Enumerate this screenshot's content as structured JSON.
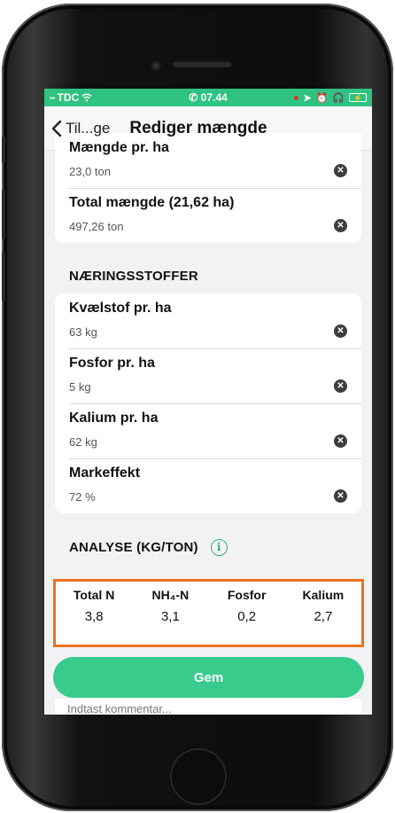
{
  "status_bar": {
    "carrier": "TDC",
    "time": "07.44"
  },
  "nav": {
    "back_label": "Til...ge",
    "title": "Rediger mængde"
  },
  "quantity_fields": [
    {
      "label": "Mængde pr. ha",
      "value": "23,0 ton"
    },
    {
      "label": "Total mængde (21,62 ha)",
      "value": "497,26 ton"
    }
  ],
  "nutrients": {
    "title": "NÆRINGSSTOFFER",
    "fields": [
      {
        "label": "Kvælstof pr. ha",
        "value": "63 kg"
      },
      {
        "label": "Fosfor pr. ha",
        "value": "5 kg"
      },
      {
        "label": "Kalium pr. ha",
        "value": "62 kg"
      },
      {
        "label": "Markeffekt",
        "value": "72 %"
      }
    ]
  },
  "analysis": {
    "title": "ANALYSE (KG/TON)",
    "columns": [
      {
        "header": "Total N",
        "value": "3,8"
      },
      {
        "header": "NH₄-N",
        "value": "3,1"
      },
      {
        "header": "Fosfor",
        "value": "0,2"
      },
      {
        "header": "Kalium",
        "value": "2,7"
      }
    ]
  },
  "actions": {
    "save_label": "Gem",
    "comment_placeholder": "Indtast kommentar..."
  },
  "colors": {
    "status_bar": "#30c281",
    "save_button": "#37cb8c",
    "highlight_border": "#e8731f",
    "info_icon": "#2fb26e"
  }
}
